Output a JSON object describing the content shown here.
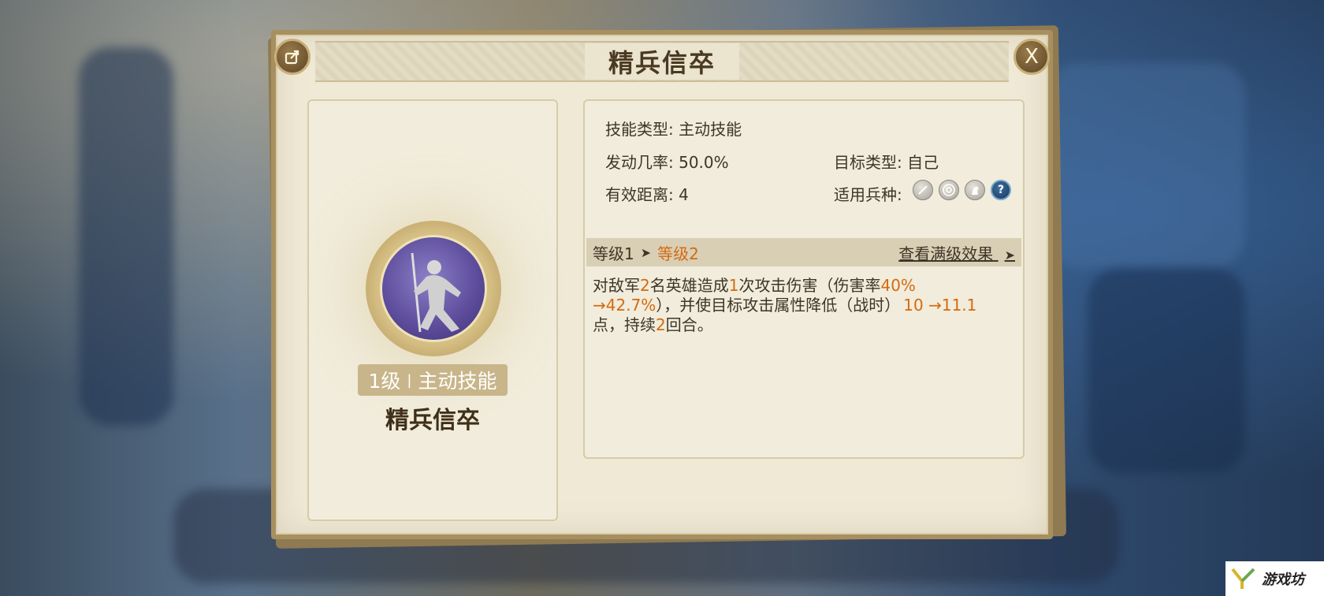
{
  "dialog": {
    "title": "精兵信卒",
    "close_label": "X"
  },
  "skill_card": {
    "badge_level": "1级",
    "badge_type": "主动技能",
    "name": "精兵信卒"
  },
  "info": {
    "skill_type_label": "技能类型:",
    "skill_type_value": "主动技能",
    "trigger_rate_label": "发动几率:",
    "trigger_rate_value": "50.0%",
    "target_type_label": "目标类型:",
    "target_type_value": "自己",
    "range_label": "有效距离:",
    "range_value": "4",
    "troop_label": "适用兵种:",
    "troop_icons": [
      "sword-icon",
      "bow-target-icon",
      "horse-icon",
      "question-icon"
    ],
    "troop_q": "?"
  },
  "level_bar": {
    "from": "等级1",
    "to": "等级2",
    "full_effect": "查看满级效果"
  },
  "description": {
    "p1": "对敌军",
    "n1": "2",
    "p2": "名英雄造成",
    "n2": "1",
    "p3": "次攻击伤害（伤害率",
    "n3": "40%",
    "n4": "→42.7%",
    "p4": "），并使目标攻击属性降低（战时）",
    "n5": "10 →11.1",
    "p5": "点，持续",
    "n6": "2",
    "p6": "回合。"
  },
  "watermark": {
    "text": "游戏坊"
  },
  "colors": {
    "accent_orange": "#d56a12",
    "panel_bg": "#efe9d6",
    "frame": "#a88f5f"
  }
}
